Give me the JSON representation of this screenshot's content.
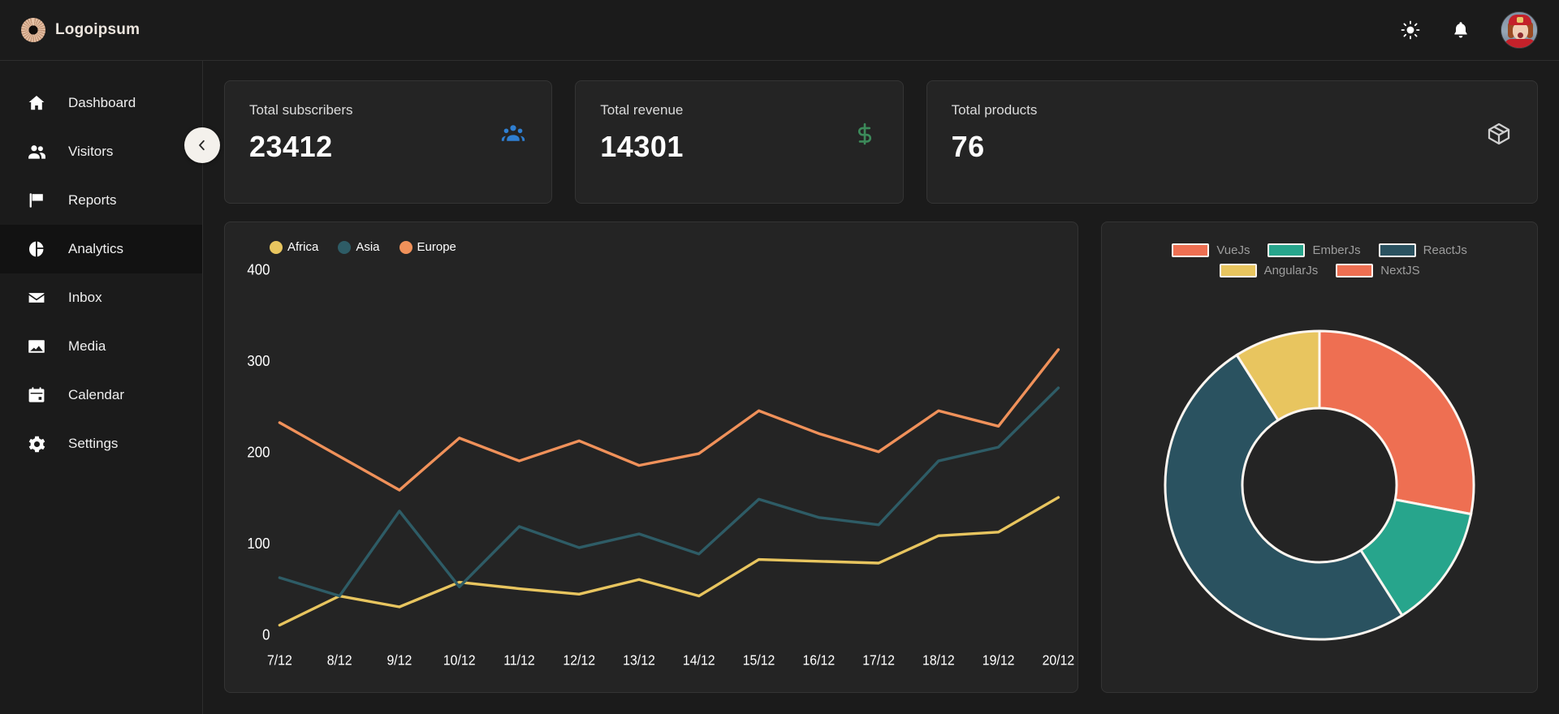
{
  "topbar": {
    "brand_name": "Logoipsum",
    "brand_icon": "sunburst-logo-icon",
    "theme_toggle_icon": "sun-icon",
    "notifications_icon": "bell-icon",
    "avatar_icon": "user-avatar"
  },
  "sidebar": {
    "collapse_icon": "chevron-left-icon",
    "items": [
      {
        "label": "Dashboard",
        "icon": "home-icon",
        "active": false
      },
      {
        "label": "Visitors",
        "icon": "people-icon",
        "active": false
      },
      {
        "label": "Reports",
        "icon": "flag-icon",
        "active": false
      },
      {
        "label": "Analytics",
        "icon": "pie-chart-icon",
        "active": true
      },
      {
        "label": "Inbox",
        "icon": "envelope-icon",
        "active": false
      },
      {
        "label": "Media",
        "icon": "image-icon",
        "active": false
      },
      {
        "label": "Calendar",
        "icon": "calendar-icon",
        "active": false
      },
      {
        "label": "Settings",
        "icon": "gear-icon",
        "active": false
      }
    ]
  },
  "stats": [
    {
      "label": "Total subscribers",
      "value": "23412",
      "icon": "group-people-icon",
      "icon_color": "#2f7fd1"
    },
    {
      "label": "Total revenue",
      "value": "14301",
      "icon": "dollar-icon",
      "icon_color": "#3c8a5a"
    },
    {
      "label": "Total products",
      "value": "76",
      "icon": "box-icon",
      "icon_color": "#cfcfcf"
    }
  ],
  "chart_data": [
    {
      "type": "line",
      "title": "",
      "xlabel": "",
      "ylabel": "",
      "grid": false,
      "legend_position": "top-left",
      "ylim": [
        0,
        400
      ],
      "yticks": [
        0,
        100,
        200,
        300,
        400
      ],
      "categories": [
        "7/12",
        "8/12",
        "9/12",
        "10/12",
        "11/12",
        "12/12",
        "13/12",
        "14/12",
        "15/12",
        "16/12",
        "17/12",
        "18/12",
        "19/12",
        "20/12"
      ],
      "series": [
        {
          "name": "Africa",
          "color": "#e8c55f",
          "values": [
            10,
            42,
            30,
            57,
            50,
            44,
            60,
            42,
            82,
            80,
            78,
            108,
            112,
            150
          ]
        },
        {
          "name": "Asia",
          "color": "#2e5c66",
          "values": [
            62,
            42,
            135,
            52,
            118,
            95,
            110,
            88,
            148,
            128,
            120,
            190,
            205,
            270
          ]
        },
        {
          "name": "Europe",
          "color": "#f0915a",
          "values": [
            232,
            195,
            158,
            215,
            190,
            212,
            185,
            198,
            245,
            220,
            200,
            245,
            228,
            312
          ]
        }
      ]
    },
    {
      "type": "pie",
      "variant": "donut",
      "title": "",
      "legend_position": "top",
      "labels": [
        "VueJs",
        "EmberJs",
        "ReactJs",
        "AngularJs",
        "NextJS"
      ],
      "colors": [
        "#ee6f52",
        "#27a58c",
        "#2a5260",
        "#e8c55f",
        "#ee6f52"
      ],
      "values": [
        28,
        13,
        50,
        9,
        0
      ]
    }
  ]
}
